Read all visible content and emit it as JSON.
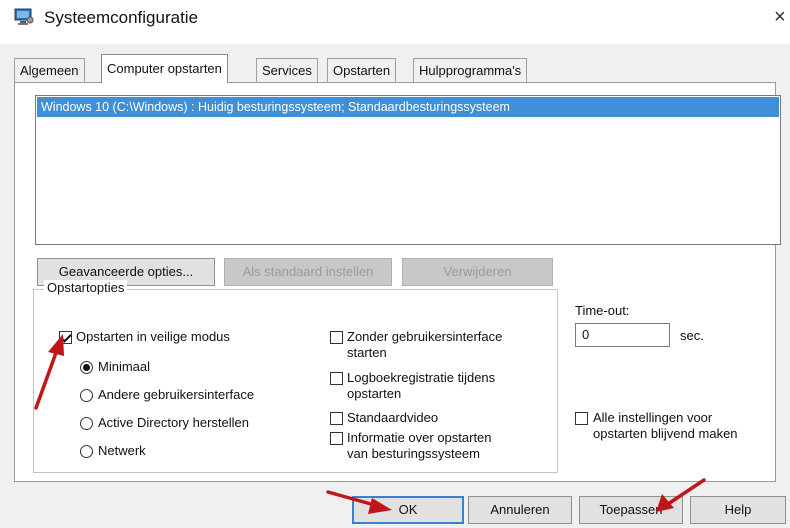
{
  "window": {
    "title": "Systeemconfiguratie",
    "close_glyph": "×",
    "icon": "system-config-icon"
  },
  "tabs": [
    {
      "label": "Algemeen",
      "active": false
    },
    {
      "label": "Computer opstarten",
      "active": true
    },
    {
      "label": "Services",
      "active": false
    },
    {
      "label": "Opstarten",
      "active": false
    },
    {
      "label": "Hulpprogramma's",
      "active": false
    }
  ],
  "boot_list": {
    "entries": [
      "Windows 10 (C:\\Windows) : Huidig besturingssysteem; Standaardbesturingssysteem"
    ],
    "selected_index": 0
  },
  "boot_buttons": {
    "advanced": "Geavanceerde opties...",
    "set_default": "Als standaard instellen",
    "delete": "Verwijderen"
  },
  "boot_options": {
    "legend": "Opstartopties",
    "safe_boot": {
      "label": "Opstarten in veilige modus",
      "checked": true
    },
    "modes": [
      {
        "label": "Minimaal",
        "selected": true
      },
      {
        "label": "Andere gebruikersinterface",
        "selected": false
      },
      {
        "label": "Active Directory herstellen",
        "selected": false
      },
      {
        "label": "Netwerk",
        "selected": false
      }
    ],
    "no_gui": {
      "label_line1": "Zonder gebruikersinterface",
      "label_line2": "starten",
      "checked": false
    },
    "boot_log": {
      "label_line1": "Logboekregistratie tijdens",
      "label_line2": "opstarten",
      "checked": false
    },
    "base_video": {
      "label": "Standaardvideo",
      "checked": false
    },
    "os_boot_info": {
      "label_line1": "Informatie over opstarten",
      "label_line2": "van besturingssysteem",
      "checked": false
    }
  },
  "timeout": {
    "label": "Time-out:",
    "value": "0",
    "unit": "sec."
  },
  "make_permanent": {
    "label_line1": "Alle instellingen voor",
    "label_line2": "opstarten blijvend maken",
    "checked": false
  },
  "footer_buttons": {
    "ok": "OK",
    "cancel": "Annuleren",
    "apply": "Toepassen",
    "help": "Help"
  },
  "colors": {
    "selection": "#3f8fd6",
    "annotation_arrow": "#c0161b",
    "default_button_border": "#3c7fd1"
  }
}
